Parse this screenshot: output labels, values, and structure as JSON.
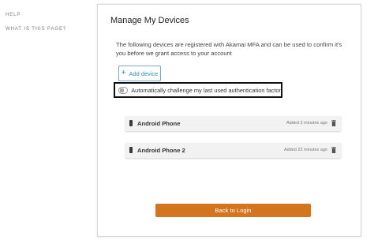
{
  "sidebar": {
    "help_label": "HELP",
    "what_label": "WHAT IS THIS PAGE?"
  },
  "main": {
    "title": "Manage My Devices",
    "description": "The following devices are registered with Akamai MFA and can be used to confirm it's you before we grant access to your account",
    "add_device_label": "Add device",
    "challenge_label": "Automatically challenge my last used authentication factor",
    "challenge_enabled": false,
    "devices": [
      {
        "name": "Android Phone",
        "added": "Added 2 minutes ago",
        "icon": "phone-icon"
      },
      {
        "name": "Android Phone 2",
        "added": "Added 22 minutes ago",
        "icon": "phone-icon"
      }
    ],
    "back_button_label": "Back to Login"
  },
  "colors": {
    "accent": "#2a8fbd",
    "primary_button": "#d4741c"
  }
}
